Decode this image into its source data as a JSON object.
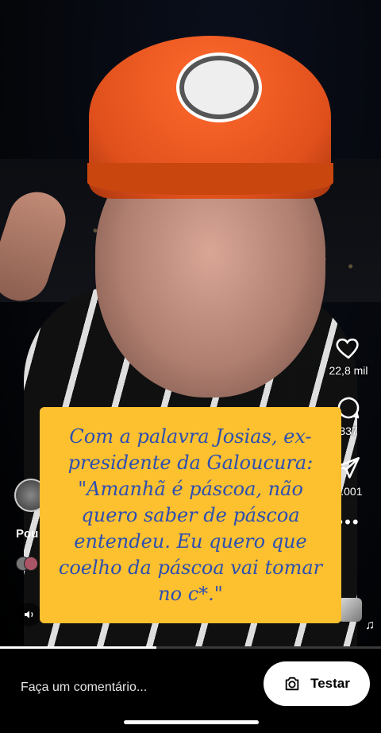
{
  "caption": {
    "text": "Com a palavra Josias, ex-presidente da Galoucura: \"Amanhã é páscoa, não quero saber de páscoa entendeu. Eu quero que coelho da páscoa vai tomar no c*.\""
  },
  "rail": {
    "likes_count": "22,8 mil",
    "comments_count": "337",
    "shares_count": "1.001",
    "icons": [
      "heart-icon",
      "comment-icon",
      "share-icon",
      "more-icon"
    ]
  },
  "author": {
    "name_partial": "Pou"
  },
  "progress": {
    "fraction": 0.41
  },
  "bottom_bar": {
    "comment_placeholder": "Faça um comentário...",
    "action_label": "Testar"
  },
  "colors": {
    "caption_bg": "#fdc02f",
    "caption_text": "#2d4fb0",
    "accent": "#ffffff"
  }
}
